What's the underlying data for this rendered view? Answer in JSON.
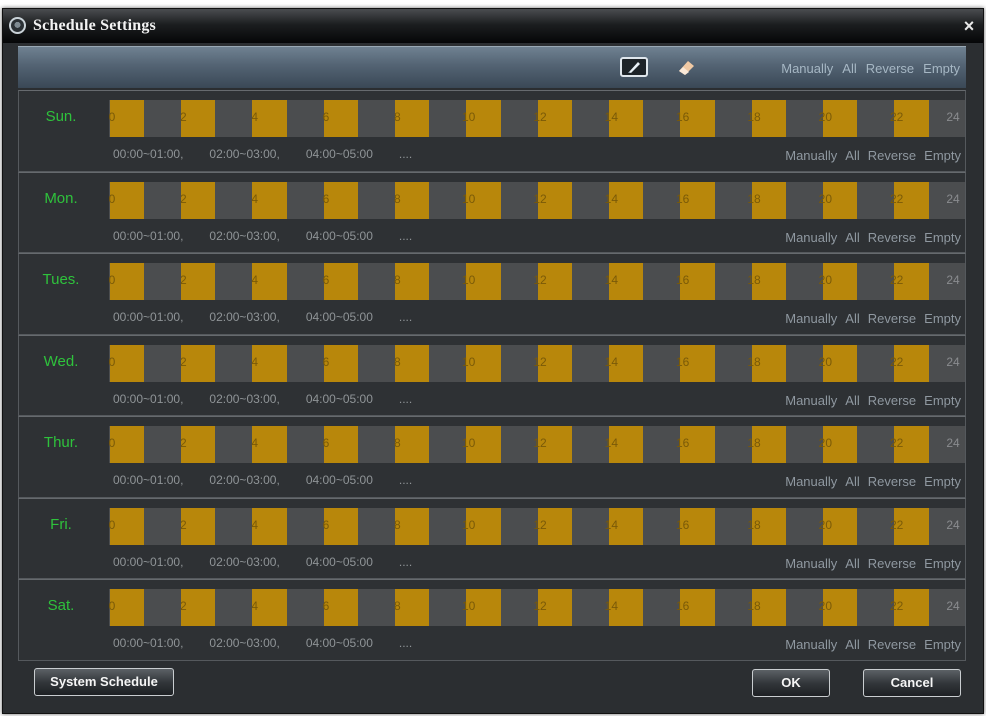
{
  "window": {
    "title": "Schedule Settings",
    "title_icon": "camera-icon",
    "close_label": "×"
  },
  "toolbar": {
    "pen_icon": "pen-icon",
    "eraser_icon": "eraser-icon",
    "actions": [
      "Manually",
      "All",
      "Reverse",
      "Empty"
    ]
  },
  "schedule": {
    "hours_total": 24,
    "ticks": [
      "0",
      "2",
      "4",
      "6",
      "8",
      "10",
      "12",
      "14",
      "16",
      "18",
      "20",
      "22",
      "24"
    ],
    "scheduled_hours": [
      0,
      2,
      4,
      6,
      8,
      10,
      12,
      14,
      16,
      18,
      20,
      22
    ],
    "segment_color": "#b8870b",
    "empty_color": "#4b4d4f",
    "label_color": "#2ec23c",
    "ranges": [
      "00:00~01:00,",
      "02:00~03:00,",
      "04:00~05:00",
      "...."
    ],
    "row_actions": [
      "Manually",
      "All",
      "Reverse",
      "Empty"
    ],
    "days": [
      {
        "label": "Sun."
      },
      {
        "label": "Mon."
      },
      {
        "label": "Tues."
      },
      {
        "label": "Wed."
      },
      {
        "label": "Thur."
      },
      {
        "label": "Fri."
      },
      {
        "label": "Sat."
      }
    ]
  },
  "buttons": {
    "system_schedule": "System Schedule",
    "ok": "OK",
    "cancel": "Cancel"
  }
}
